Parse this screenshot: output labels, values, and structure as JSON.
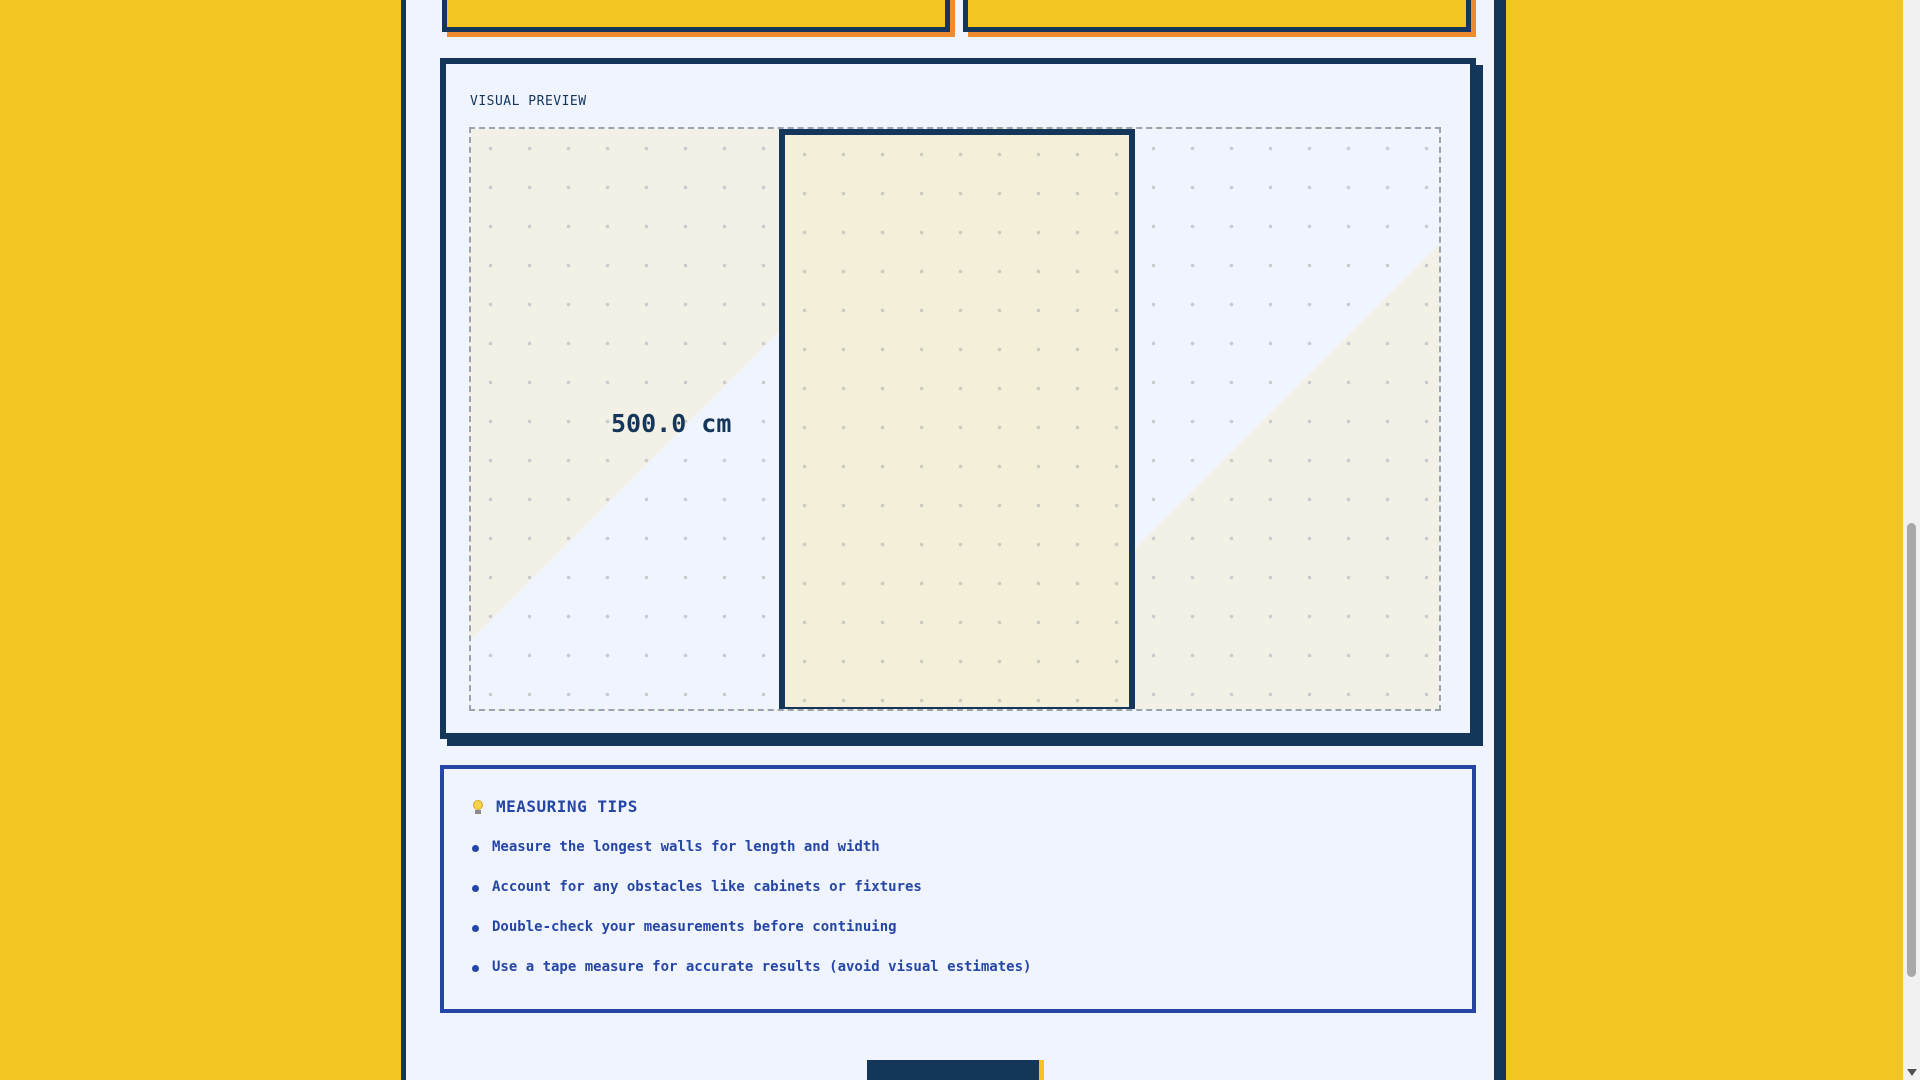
{
  "preview": {
    "label": "VISUAL PREVIEW",
    "dimension_label": "500.0 cm"
  },
  "tips": {
    "icon": "lightbulb-icon",
    "title": "MEASURING TIPS",
    "items": [
      "Measure the longest walls for length and width",
      "Account for any obstacles like cabinets or fixtures",
      "Double-check your measurements before continuing",
      "Use a tape measure for accurate results (avoid visual estimates)"
    ]
  },
  "colors": {
    "background": "#F2C521",
    "panel": "#EFF4FE",
    "navy": "#14365B",
    "accent_blue": "#2646A6",
    "accent_orange": "#EE8B2F"
  }
}
